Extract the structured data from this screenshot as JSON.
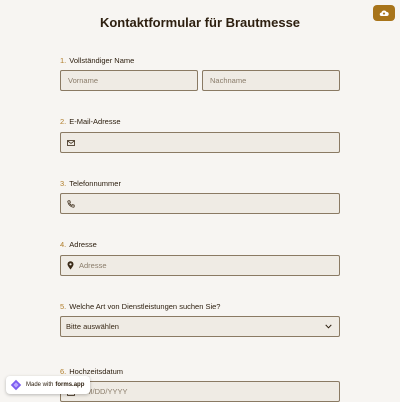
{
  "form": {
    "title": "Kontaktformular für Brautmesse",
    "questions": [
      {
        "number": "1.",
        "label": "Vollständiger Name",
        "first_placeholder": "Vorname",
        "last_placeholder": "Nachname"
      },
      {
        "number": "2.",
        "label": "E-Mail-Adresse",
        "icon": "envelope-icon"
      },
      {
        "number": "3.",
        "label": "Telefonnummer",
        "icon": "phone-icon"
      },
      {
        "number": "4.",
        "label": "Adresse",
        "icon": "location-pin-icon",
        "placeholder": "Adresse"
      },
      {
        "number": "5.",
        "label": "Welche Art von Dienstleistungen suchen Sie?",
        "selected": "Bitte auswählen",
        "icon": "chevron-down-icon"
      },
      {
        "number": "6.",
        "label": "Hochzeitsdatum",
        "icon": "calendar-icon",
        "placeholder": "MM/DD/YYYY"
      }
    ]
  },
  "corner_button": {
    "icon": "cloud-upload-icon"
  },
  "badge": {
    "prefix": "Made with",
    "brand": "forms.app",
    "icon": "forms-app-logo"
  },
  "colors": {
    "accent": "#a8741a",
    "field_bg": "#efebe4",
    "field_border": "#8a7a63",
    "page_bg": "#f7f5f2",
    "number_color": "#b07d2a"
  }
}
